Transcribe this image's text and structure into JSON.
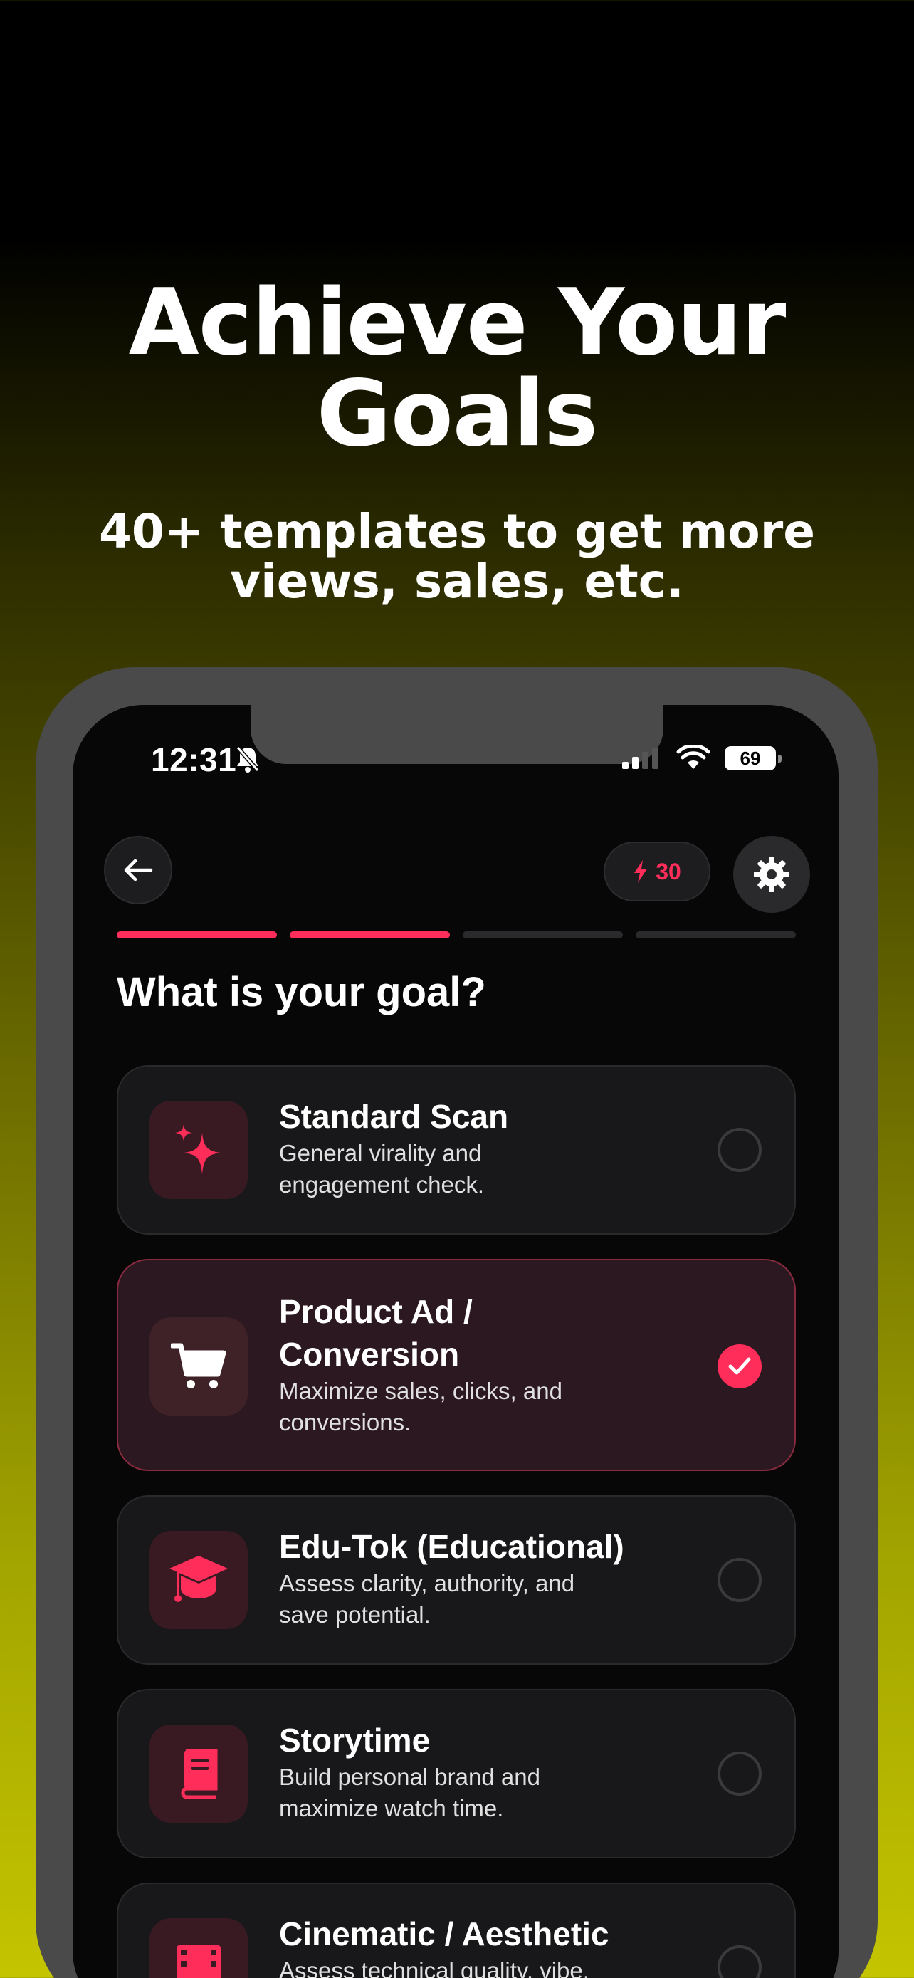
{
  "hero": {
    "title_line1": "Achieve Your",
    "title_line2": "Goals",
    "subtitle_line1": "40+ templates to get more",
    "subtitle_line2": "views, sales, etc."
  },
  "status_bar": {
    "time": "12:31",
    "battery": "69"
  },
  "header": {
    "credits": "30",
    "back_icon": "arrow-left-icon",
    "settings_icon": "gear-icon",
    "credits_icon": "bolt-icon"
  },
  "progress": {
    "total_steps": 4,
    "completed_steps": 2
  },
  "question": "What is your goal?",
  "options": [
    {
      "title": "Standard Scan",
      "desc_line1": "General virality and",
      "desc_line2": "engagement check.",
      "icon": "sparkles-icon",
      "selected": false
    },
    {
      "title": "Product Ad /",
      "title_line2": "Conversion",
      "desc_line1": "Maximize sales, clicks, and",
      "desc_line2": "conversions.",
      "icon": "cart-icon",
      "selected": true
    },
    {
      "title": "Edu-Tok (Educational)",
      "desc_line1": "Assess clarity, authority, and",
      "desc_line2": "save potential.",
      "icon": "graduation-cap-icon",
      "selected": false
    },
    {
      "title": "Storytime",
      "desc_line1": "Build personal brand and",
      "desc_line2": "maximize watch time.",
      "icon": "book-icon",
      "selected": false
    },
    {
      "title": "Cinematic / Aesthetic",
      "desc_line1": "Assess technical quality, vibe,",
      "desc_line2": "",
      "icon": "film-icon",
      "selected": false
    }
  ],
  "colors": {
    "accent": "#ff2d5a",
    "card": "#18181a",
    "card_selected": "#2c1820"
  }
}
